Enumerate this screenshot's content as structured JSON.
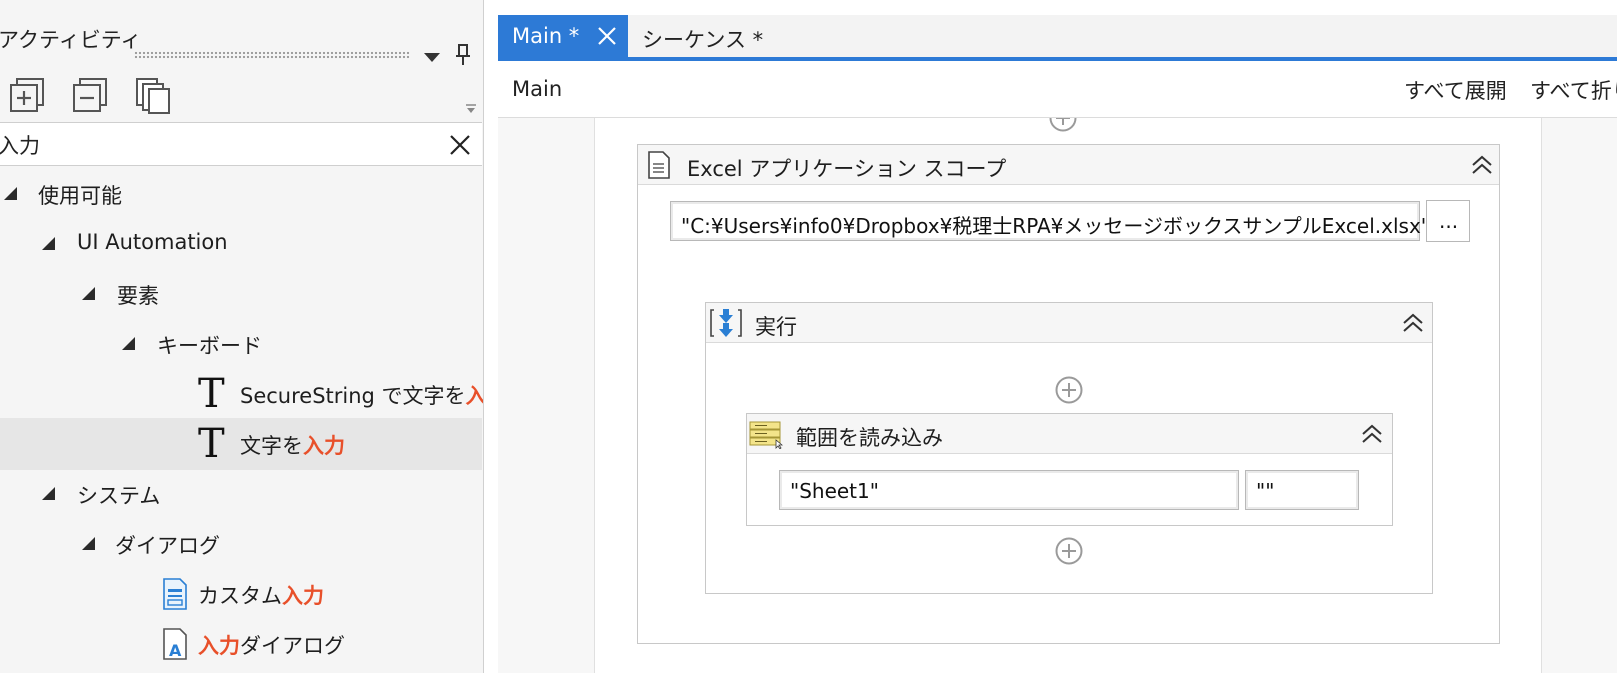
{
  "left_panel": {
    "title": "アクティビティ",
    "search": {
      "value": "入力"
    },
    "tree": [
      {
        "label": "使用可能",
        "level": 0,
        "type": "group"
      },
      {
        "label": "UI Automation",
        "level": 1,
        "type": "group"
      },
      {
        "label": "要素",
        "level": 2,
        "type": "group"
      },
      {
        "label": "キーボード",
        "level": 3,
        "type": "group"
      },
      {
        "label_pre": "SecureString で文字を",
        "label_hl": "入",
        "label_post": "",
        "type": "activity",
        "icon": "text-type-icon"
      },
      {
        "label_pre": "文字を",
        "label_hl": "入力",
        "label_post": "",
        "type": "activity",
        "icon": "text-type-icon",
        "selected": true
      },
      {
        "label": "システム",
        "level": 1,
        "type": "group"
      },
      {
        "label": "ダイアログ",
        "level": 2,
        "type": "group"
      },
      {
        "label_pre": "カスタム",
        "label_hl": "入力",
        "label_post": "",
        "type": "activity",
        "icon": "custom-input-icon"
      },
      {
        "label_pre": "",
        "label_hl": "入力",
        "label_post": "ダイアログ",
        "type": "activity",
        "icon": "input-dialog-icon"
      }
    ]
  },
  "designer": {
    "tabs": [
      {
        "label": "Main *",
        "active": true
      },
      {
        "label": "シーケンス *",
        "active": false
      }
    ],
    "breadcrumb": "Main",
    "expand_all": "すべて展開",
    "collapse_all": "すべて折りたたみ",
    "excel_scope": {
      "title": "Excel アプリケーション スコープ",
      "path": "\"C:¥Users¥info0¥Dropbox¥税理士RPA¥メッセージボックスサンプルExcel.xlsx\"",
      "browse_label": "..."
    },
    "do_block": {
      "title": "実行"
    },
    "read_range": {
      "title": "範囲を読み込み",
      "sheet": "\"Sheet1\"",
      "range": "\"\""
    }
  },
  "colors": {
    "accent": "#2d7ad6",
    "highlight": "#e8502a",
    "panel_bg": "#f5f5f5",
    "selected_bg": "#e6e6e6"
  }
}
